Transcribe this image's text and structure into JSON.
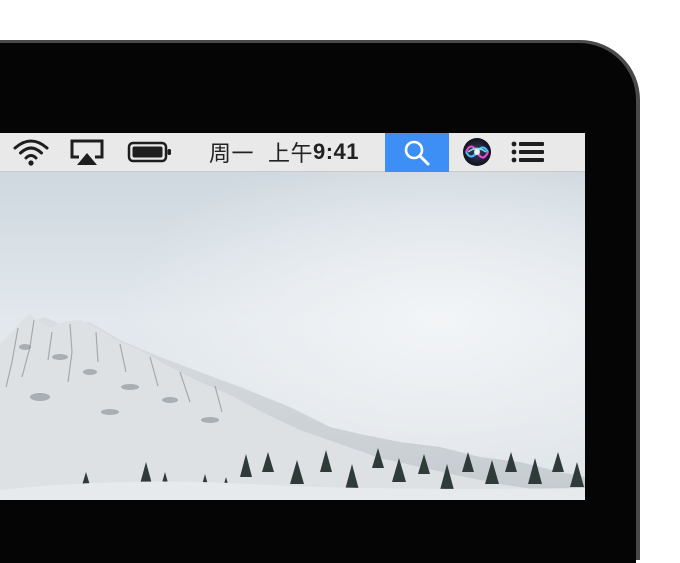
{
  "menubar": {
    "clock": {
      "day": "周一",
      "period": "上午",
      "time": "9:41"
    },
    "items": {
      "wifi": "wifi-icon",
      "airplay": "airplay-icon",
      "battery": "battery-icon",
      "spotlight": "search-icon",
      "siri": "siri-icon",
      "notification_center": "list-icon"
    },
    "spotlight_active_color": "#3d8ff5"
  },
  "colors": {
    "menubar_bg": "#e9e9ea",
    "bezel": "#48494b",
    "frame": "#050505",
    "sky": "#dfe6ec",
    "snow": "#e4e8ec",
    "tree": "#2f3b38"
  }
}
